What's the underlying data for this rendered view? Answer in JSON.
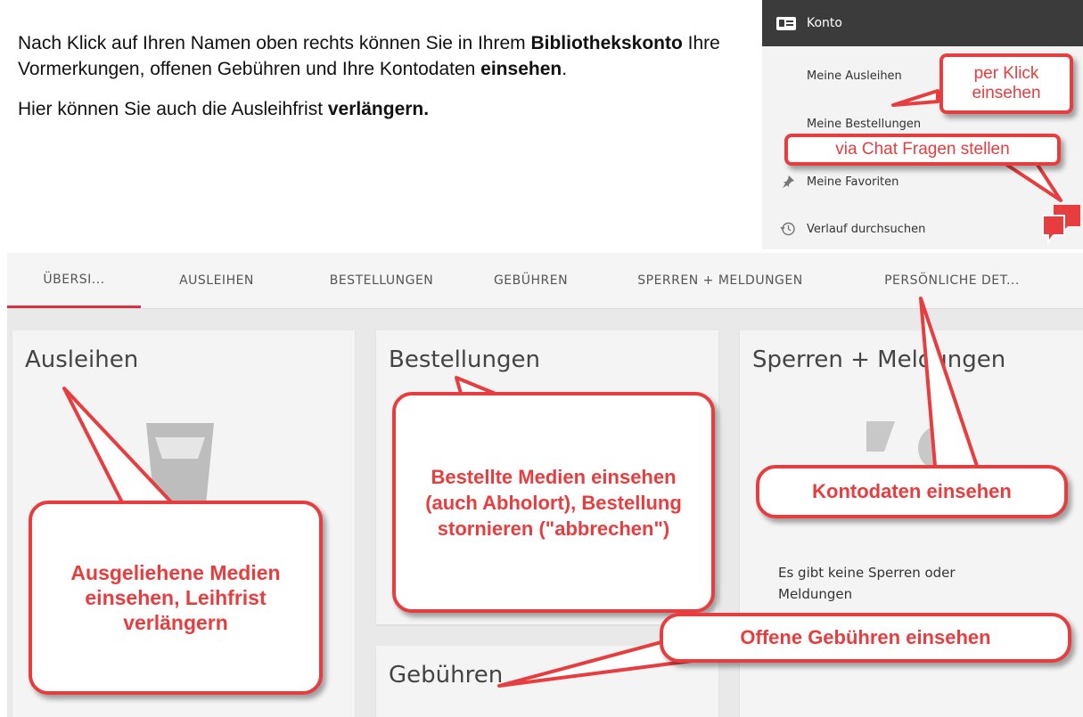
{
  "intro": {
    "p1_a": "Nach Klick auf Ihren Namen oben rechts können Sie in Ihrem ",
    "p1_b": "Bibliothekskonto",
    "p1_c": " Ihre Vormerkungen, offenen Gebühren und Ihre Kontodaten ",
    "p1_d": "einsehen",
    "p1_e": ".",
    "p2_a": "Hier können Sie auch die Ausleihfrist ",
    "p2_b": "verlängern."
  },
  "account_menu": {
    "header": "Konto",
    "items": [
      {
        "label": "Meine Ausleihen",
        "icon": "none"
      },
      {
        "label": "Meine Bestellungen",
        "icon": "none"
      },
      {
        "label": "Meine Favoriten",
        "icon": "pin-icon"
      },
      {
        "label": "Verlauf durchsuchen",
        "icon": "history-icon"
      }
    ]
  },
  "tabs": [
    {
      "label": "ÜBERSI..."
    },
    {
      "label": "AUSLEIHEN"
    },
    {
      "label": "BESTELLUNGEN"
    },
    {
      "label": "GEBÜHREN"
    },
    {
      "label": "SPERREN + MELDUNGEN"
    },
    {
      "label": "PERSÖNLICHE DET..."
    }
  ],
  "panels": {
    "loans": {
      "title": "Ausleihen"
    },
    "orders": {
      "title": "Bestellungen"
    },
    "blocks": {
      "title": "Sperren + Meldungen",
      "empty": "Es gibt keine Sperren oder Meldungen"
    },
    "fees": {
      "title": "Gebühren"
    }
  },
  "callouts": {
    "click_view": "per Klick einsehen",
    "chat": "via Chat Fragen stellen",
    "loans": "Ausgeliehene Medien einsehen, Leihfrist verlängern",
    "orders": "Bestellte Medien einsehen (auch Abholort), Bestellung stornieren (\"abbrechen\")",
    "account": "Kontodaten einsehen",
    "fees": "Offene Gebühren einsehen"
  },
  "colors": {
    "accent_red": "#e83d3f",
    "tab_active": "#d73243",
    "header_dark": "#3b3b3b"
  }
}
